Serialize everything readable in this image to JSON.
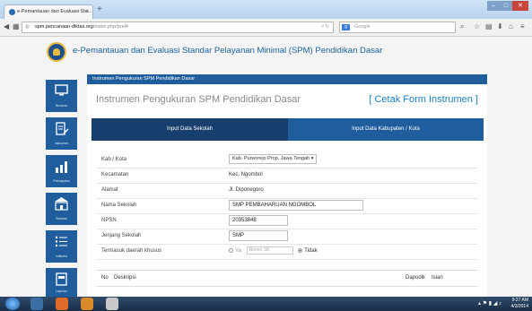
{
  "browser": {
    "tab_title": "e-Pemantauan dan Evaluasi Sta...",
    "new_tab_symbol": "+",
    "url_domain": "spm.pencanaan-diktas.org",
    "url_path": "/index.php/prel4",
    "search_placeholder": "Google",
    "window_controls": [
      "–",
      "□",
      "✕"
    ]
  },
  "header": {
    "site_title": "e-Pemantauan dan Evaluasi Standar Pelayanan Minimal (SPM) Pendidikan Dasar"
  },
  "sidebar": {
    "items": [
      {
        "label": "Beranda",
        "icon": "monitor-icon"
      },
      {
        "label": "Instrumen",
        "icon": "document-edit-icon"
      },
      {
        "label": "Pencapaian",
        "icon": "bar-chart-icon"
      },
      {
        "label": "Sekolah",
        "icon": "building-icon"
      },
      {
        "label": "Indikator",
        "icon": "list-icon"
      },
      {
        "label": "Laporan",
        "icon": "report-icon"
      }
    ]
  },
  "content": {
    "bar_title": "Instrumen Pengukuran SPM Pendidikan Dasar",
    "title": "Instrumen Pengukuran SPM Pendidikan Dasar",
    "print_link": "[ Cetak Form Instrumen ]",
    "tabs": [
      "Input Data Sekolah",
      "Input Data Kabupaten / Kota"
    ],
    "form": {
      "kab_kota_label": "Kab / Kota",
      "kab_kota_value": "Kab. Purworejo Prop. Jawa Tengah",
      "kecamatan_label": "Kecamatan",
      "kecamatan_value": "Kec. Ngombol",
      "alamat_label": "Alamat",
      "alamat_value": "Jl. Diponegoro",
      "nama_sekolah_label": "Nama Sekolah",
      "nama_sekolah_value": "SMP PEMBAHARUAN NGOMBOL",
      "npsn_label": "NPSN",
      "npsn_value": "20353848",
      "jenjang_label": "Jenjang Sekolah",
      "jenjang_value": "SMP",
      "daerah_khusus_label": "Termasuk daerah khusus",
      "ya_label": "Ya",
      "nomor_sk_placeholder": "Nomor SK",
      "tidak_label": "Tidak"
    },
    "table": {
      "col_no": "No",
      "col_deskripsi": "Deskripsi",
      "col_dapodik": "Dapodik",
      "col_isian": "Isian"
    }
  },
  "taskbar": {
    "time": "9:27 AM",
    "date": "4/3/2014"
  },
  "colors": {
    "primary_blue": "#1f5d9c",
    "active_tab": "#163f6d",
    "link_blue": "#1a7fc3"
  }
}
